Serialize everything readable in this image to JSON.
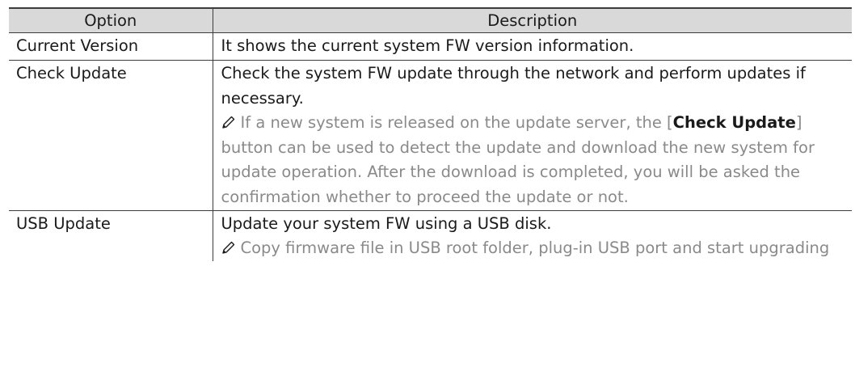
{
  "table": {
    "headers": [
      "Option",
      "Description"
    ],
    "rows": [
      {
        "option": "Current Version",
        "description": "It shows the current system FW version information."
      },
      {
        "option": "Check Update",
        "description": "Check the system FW update through the network and perform updates if necessary.",
        "note": {
          "icon": "pencil-icon",
          "pre": "If a new system is released on the update server, the [",
          "button_name": "Check Update",
          "post": "] button can be used to detect the update and download the new system for update operation. After the download is completed, you will be asked the confirmation whether to proceed the update or not."
        }
      },
      {
        "option": "USB Update",
        "description": "Update your system FW using a USB disk.",
        "note": {
          "icon": "pencil-icon",
          "text": "Copy firmware file in USB root folder, plug-in USB port and start upgrading"
        }
      }
    ]
  },
  "colors": {
    "header_bg": "#d9d9d9",
    "note_text": "#8a8a8a",
    "border": "#3c3c3c"
  }
}
